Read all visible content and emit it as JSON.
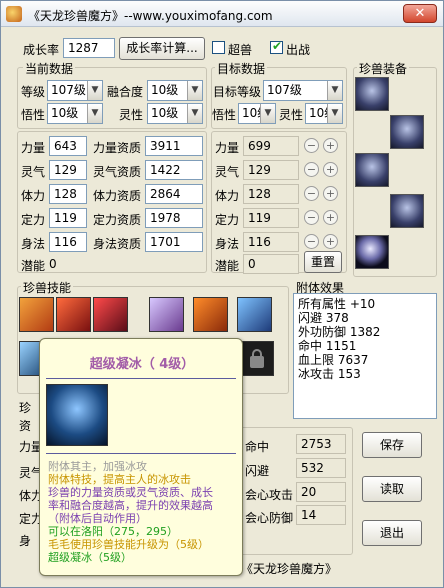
{
  "titlebar": {
    "title": "《天龙珍兽魔方》--www.youximofang.com",
    "close": "✕"
  },
  "top": {
    "growth_label": "成长率",
    "growth_value": "1287",
    "calc_button": "成长率计算...",
    "super_label": "超兽",
    "fight_label": "出战"
  },
  "current": {
    "group": "当前数据",
    "level_label": "等级",
    "level_value": "107级",
    "fusion_label": "融合度",
    "fusion_value": "10级",
    "wuxing_label": "悟性",
    "wuxing_value": "10级",
    "lingxing_label": "灵性",
    "lingxing_value": "10级"
  },
  "target": {
    "group": "目标数据",
    "level_label": "目标等级",
    "level_value": "107级",
    "wuxing_label": "悟性",
    "wuxing_value": "10级",
    "lingxing_label": "灵性",
    "lingxing_value": "10级"
  },
  "equip": {
    "group": "珍兽装备"
  },
  "attrs": [
    {
      "label": "力量",
      "value": "643",
      "apt_label": "力量资质",
      "apt_value": "3911",
      "target": "699"
    },
    {
      "label": "灵气",
      "value": "129",
      "apt_label": "灵气资质",
      "apt_value": "1422",
      "target": "129"
    },
    {
      "label": "体力",
      "value": "128",
      "apt_label": "体力资质",
      "apt_value": "2864",
      "target": "128"
    },
    {
      "label": "定力",
      "value": "119",
      "apt_label": "定力资质",
      "apt_value": "1978",
      "target": "119"
    },
    {
      "label": "身法",
      "value": "116",
      "apt_label": "身法资质",
      "apt_value": "1701",
      "target": "116"
    }
  ],
  "potential": {
    "label": "潜能",
    "value": "0",
    "target_value": "0",
    "reset": "重置"
  },
  "skills": {
    "group": "珍兽技能"
  },
  "attach": {
    "group": "附体效果",
    "items": [
      "所有属性  +10",
      "闪避  378",
      "外功防御  1382",
      "命中  1151",
      "血上限  7637",
      "冰攻击  153"
    ]
  },
  "bottom": {
    "hit_label": "命中",
    "hit_value": "2753",
    "dodge_label": "闪避",
    "dodge_value": "532",
    "crit_label": "会心攻击",
    "crit_value": "20",
    "critdef_label": "会心防御",
    "critdef_value": "14",
    "save": "保存",
    "load": "读取",
    "exit": "退出",
    "partial": [
      "珍",
      "资",
      "力量",
      "灵气",
      "体力",
      "定力",
      "身"
    ]
  },
  "tooltip": {
    "title": "超级凝冰（ 4级）",
    "lines": [
      "附体其主，加强冰攻",
      "附体特技，提高主人的冰攻击",
      "珍兽的力量资质或灵气资质、成长",
      "率和融合度越高，提升的效果越高",
      "（附体后自动作用）",
      "可以在洛阳",
      "使用珍兽技能升级为",
      "超级凝冰（5级）"
    ],
    "coord": "（275，295）",
    "npc": "毛毛",
    "book_hint": "（5级）"
  },
  "status": "《天龙珍兽魔方》",
  "colors": {
    "title_text": "#a25ca8",
    "line_green": "#20a020",
    "line_gold": "#c79400",
    "line_purple": "#7a3fb0",
    "line_gray": "#9a9a9a"
  }
}
